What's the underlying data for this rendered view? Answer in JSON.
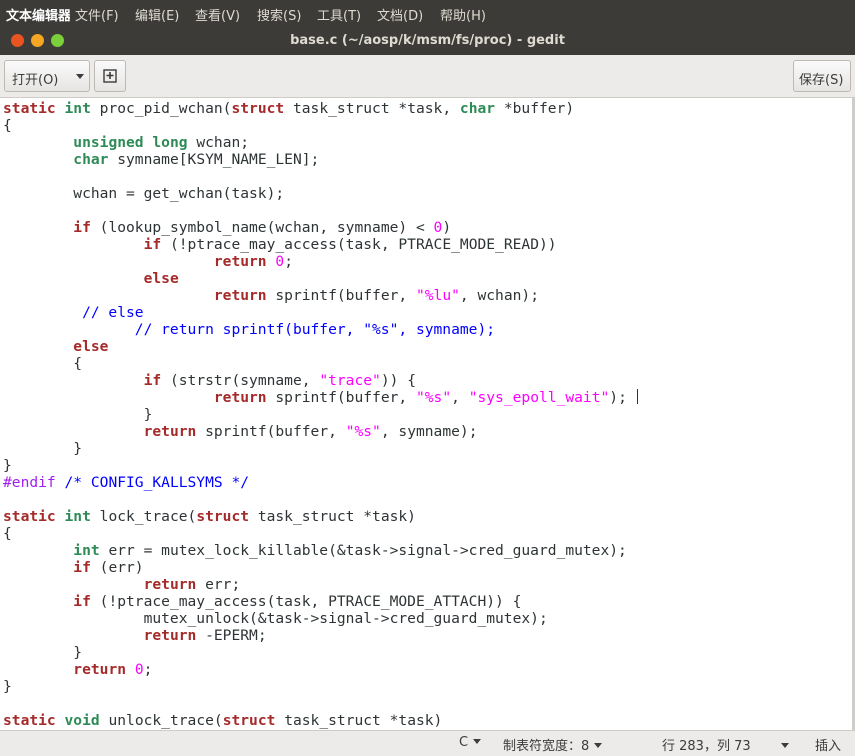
{
  "menubar": {
    "app_name": "文本编辑器",
    "items": [
      "文件(F)",
      "编辑(E)",
      "查看(V)",
      "搜索(S)",
      "工具(T)",
      "文档(D)",
      "帮助(H)"
    ]
  },
  "window": {
    "title": "base.c (~/aosp/k/msm/fs/proc) - gedit"
  },
  "toolbar": {
    "open_label": "打开(O)",
    "save_label": "保存(S)"
  },
  "editor": {
    "language": "C",
    "lines": [
      [
        [
          "kw",
          "static"
        ],
        [
          "p",
          " "
        ],
        [
          "ty",
          "int"
        ],
        [
          "p",
          " proc_pid_wchan("
        ],
        [
          "kw",
          "struct"
        ],
        [
          "p",
          " task_struct *task, "
        ],
        [
          "ty",
          "char"
        ],
        [
          "p",
          " *buffer)"
        ]
      ],
      [
        [
          "p",
          "{"
        ]
      ],
      [
        [
          "p",
          "        "
        ],
        [
          "ty",
          "unsigned"
        ],
        [
          "p",
          " "
        ],
        [
          "ty",
          "long"
        ],
        [
          "p",
          " wchan;"
        ]
      ],
      [
        [
          "p",
          "        "
        ],
        [
          "ty",
          "char"
        ],
        [
          "p",
          " symname[KSYM_NAME_LEN];"
        ]
      ],
      [],
      [
        [
          "p",
          "        wchan = get_wchan(task);"
        ]
      ],
      [],
      [
        [
          "p",
          "        "
        ],
        [
          "kw",
          "if"
        ],
        [
          "p",
          " (lookup_symbol_name(wchan, symname) < "
        ],
        [
          "num",
          "0"
        ],
        [
          "p",
          ")"
        ]
      ],
      [
        [
          "p",
          "                "
        ],
        [
          "kw",
          "if"
        ],
        [
          "p",
          " (!ptrace_may_access(task, PTRACE_MODE_READ))"
        ]
      ],
      [
        [
          "p",
          "                        "
        ],
        [
          "kw",
          "return"
        ],
        [
          "p",
          " "
        ],
        [
          "num",
          "0"
        ],
        [
          "p",
          ";"
        ]
      ],
      [
        [
          "p",
          "                "
        ],
        [
          "kw",
          "else"
        ]
      ],
      [
        [
          "p",
          "                        "
        ],
        [
          "kw",
          "return"
        ],
        [
          "p",
          " sprintf(buffer, "
        ],
        [
          "str",
          "\"%lu\""
        ],
        [
          "p",
          ", wchan);"
        ]
      ],
      [
        [
          "cm",
          "         // else"
        ]
      ],
      [
        [
          "cm",
          "               // return sprintf(buffer, \"%s\", symname);"
        ]
      ],
      [
        [
          "p",
          "        "
        ],
        [
          "kw",
          "else"
        ]
      ],
      [
        [
          "p",
          "        {"
        ]
      ],
      [
        [
          "p",
          "                "
        ],
        [
          "kw",
          "if"
        ],
        [
          "p",
          " (strstr(symname, "
        ],
        [
          "str",
          "\"trace\""
        ],
        [
          "p",
          ")) {"
        ]
      ],
      [
        [
          "p",
          "                        "
        ],
        [
          "kw",
          "return"
        ],
        [
          "p",
          " sprintf(buffer, "
        ],
        [
          "str",
          "\"%s\""
        ],
        [
          "p",
          ", "
        ],
        [
          "str",
          "\"sys_epoll_wait\""
        ],
        [
          "p",
          ");"
        ]
      ],
      [
        [
          "p",
          "                }"
        ]
      ],
      [
        [
          "p",
          "                "
        ],
        [
          "kw",
          "return"
        ],
        [
          "p",
          " sprintf(buffer, "
        ],
        [
          "str",
          "\"%s\""
        ],
        [
          "p",
          ", symname);"
        ]
      ],
      [
        [
          "p",
          "        }"
        ]
      ],
      [
        [
          "p",
          "}"
        ]
      ],
      [
        [
          "pp",
          "#endif"
        ],
        [
          "p",
          " "
        ],
        [
          "cm",
          "/* CONFIG_KALLSYMS */"
        ]
      ],
      [],
      [
        [
          "kw",
          "static"
        ],
        [
          "p",
          " "
        ],
        [
          "ty",
          "int"
        ],
        [
          "p",
          " lock_trace("
        ],
        [
          "kw",
          "struct"
        ],
        [
          "p",
          " task_struct *task)"
        ]
      ],
      [
        [
          "p",
          "{"
        ]
      ],
      [
        [
          "p",
          "        "
        ],
        [
          "ty",
          "int"
        ],
        [
          "p",
          " err = mutex_lock_killable(&task->signal->cred_guard_mutex);"
        ]
      ],
      [
        [
          "p",
          "        "
        ],
        [
          "kw",
          "if"
        ],
        [
          "p",
          " (err)"
        ]
      ],
      [
        [
          "p",
          "                "
        ],
        [
          "kw",
          "return"
        ],
        [
          "p",
          " err;"
        ]
      ],
      [
        [
          "p",
          "        "
        ],
        [
          "kw",
          "if"
        ],
        [
          "p",
          " (!ptrace_may_access(task, PTRACE_MODE_ATTACH)) {"
        ]
      ],
      [
        [
          "p",
          "                mutex_unlock(&task->signal->cred_guard_mutex);"
        ]
      ],
      [
        [
          "p",
          "                "
        ],
        [
          "kw",
          "return"
        ],
        [
          "p",
          " -EPERM;"
        ]
      ],
      [
        [
          "p",
          "        }"
        ]
      ],
      [
        [
          "p",
          "        "
        ],
        [
          "kw",
          "return"
        ],
        [
          "p",
          " "
        ],
        [
          "num",
          "0"
        ],
        [
          "p",
          ";"
        ]
      ],
      [
        [
          "p",
          "}"
        ]
      ],
      [],
      [
        [
          "kw",
          "static"
        ],
        [
          "p",
          " "
        ],
        [
          "ty",
          "void"
        ],
        [
          "p",
          " unlock_trace("
        ],
        [
          "kw",
          "struct"
        ],
        [
          "p",
          " task_struct *task)"
        ]
      ]
    ]
  },
  "status": {
    "language": "C",
    "tab_width": "制表符宽度：8",
    "position": "行 283，列 73",
    "mode": "插入"
  }
}
